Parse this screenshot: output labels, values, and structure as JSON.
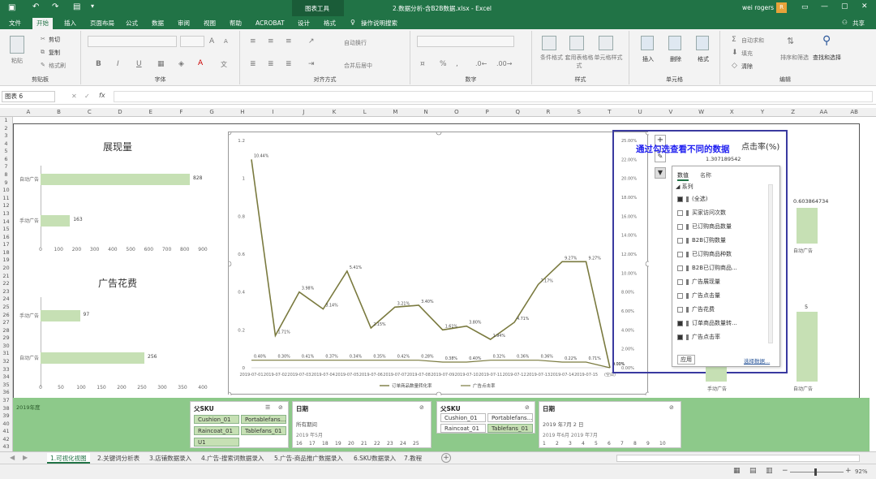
{
  "window": {
    "file_title": "2.数据分析-含B2B数据.xlsx - Excel",
    "context_title": "图表工具",
    "user": "wei rogers",
    "user_initial": "R"
  },
  "ribbon_tabs": [
    "文件",
    "开始",
    "插入",
    "页面布局",
    "公式",
    "数据",
    "审阅",
    "视图",
    "帮助",
    "ACROBAT",
    "设计",
    "格式"
  ],
  "tell_me": "操作说明搜索",
  "share": "共享",
  "ribbon": {
    "clipboard": {
      "cut": "剪切",
      "copy": "复制",
      "paste": "粘贴",
      "painter": "格式刷",
      "label": "剪贴板"
    },
    "font": {
      "bold": "B",
      "italic": "I",
      "underline": "U",
      "grow": "A",
      "shrink": "A",
      "color_a": "A",
      "wen": "文",
      "label": "字体"
    },
    "align": {
      "wrap": "自动换行",
      "merge": "合并后居中",
      "label": "对齐方式"
    },
    "number": {
      "label": "数字",
      "pct": "%",
      "comma": ","
    },
    "styles": {
      "cond": "条件格式",
      "table": "套用表格格式",
      "cell": "单元格样式",
      "label": "样式"
    },
    "cells": {
      "insert": "插入",
      "delete": "删除",
      "format": "格式",
      "label": "单元格"
    },
    "editing": {
      "autosum": "自动求和",
      "fill": "填充",
      "clear": "清除",
      "sort": "排序和筛选",
      "find": "查找和选择",
      "label": "编辑"
    }
  },
  "formula_bar": {
    "name_box": "图表 6",
    "fx": "fx",
    "value": ""
  },
  "columns": [
    "A",
    "B",
    "C",
    "D",
    "E",
    "F",
    "G",
    "H",
    "I",
    "J",
    "K",
    "L",
    "M",
    "N",
    "O",
    "P",
    "Q",
    "R",
    "S",
    "T",
    "U",
    "V",
    "W",
    "X",
    "Y",
    "Z",
    "AA",
    "AB"
  ],
  "rows": [
    "1",
    "2",
    "3",
    "4",
    "5",
    "6",
    "7",
    "8",
    "9",
    "10",
    "11",
    "12",
    "13",
    "14",
    "15",
    "16",
    "17",
    "18",
    "19",
    "20",
    "21",
    "22",
    "23",
    "24",
    "25",
    "26",
    "27",
    "28",
    "29",
    "30",
    "31",
    "32",
    "33",
    "34",
    "35",
    "36",
    "37",
    "38",
    "39",
    "40",
    "41",
    "42",
    "43"
  ],
  "charts": {
    "impressions": {
      "title": "展现量",
      "bars": [
        {
          "label": "自动广告",
          "value": 828
        },
        {
          "label": "手动广告",
          "value": 163
        }
      ],
      "axis": [
        "0",
        "100",
        "200",
        "300",
        "400",
        "500",
        "600",
        "700",
        "800",
        "900"
      ],
      "max": 900
    },
    "spend": {
      "title": "广告花费",
      "bars": [
        {
          "label": "手动广告",
          "value": 97
        },
        {
          "label": "自动广告",
          "value": 256
        }
      ],
      "axis": [
        "0",
        "50",
        "100",
        "150",
        "200",
        "250",
        "300",
        "350",
        "400"
      ],
      "max": 400
    },
    "ctr": {
      "title": "点击率(%)",
      "top_value": "1.307189542",
      "bars": [
        {
          "label": "手动广告",
          "value": "1.307189542"
        },
        {
          "label": "自动广告",
          "value": "0.603864734"
        }
      ],
      "bottom_label": "5"
    }
  },
  "chart_data": {
    "type": "line",
    "x": [
      "2019-07-01",
      "2019-07-02",
      "2019-07-03",
      "2019-07-04",
      "2019-07-05",
      "2019-07-06",
      "2019-07-07",
      "2019-07-08",
      "2019-07-09",
      "2019-07-10",
      "2019-07-11",
      "2019-07-12",
      "2019-07-13",
      "2019-07-14",
      "2019-07-15",
      "(空白)"
    ],
    "x_ticks": [
      "2019-07-01",
      "2019-07-02",
      "2019-07-03",
      "2019-07-04",
      "2019-07-05",
      "2019-07-06",
      "2019-07-07",
      "2019-07-08",
      "2019-07-09",
      "2019-07-10",
      "2019-07-11",
      "2019-07-12",
      "2019-07-13",
      "2019-07-14",
      "2019-07-15",
      "(空白)"
    ],
    "series": [
      {
        "name": "订单商品数量转化率",
        "axis": "left",
        "values": [
          1.1,
          0.17,
          0.4,
          0.31,
          0.51,
          0.21,
          0.32,
          0.33,
          0.2,
          0.22,
          0.15,
          0.24,
          0.44,
          0.56,
          0.56,
          0.0
        ],
        "labels": [
          "10.44%",
          "1.71%",
          "3.98%",
          "3.14%",
          "5.41%",
          "2.15%",
          "3.21%",
          "3.40%",
          "1.61%",
          "3.80%",
          "1.94%",
          "4.71%",
          "7.17%",
          "9.27%",
          "9.27%",
          "0.00%"
        ]
      },
      {
        "name": "广告点击率",
        "axis": "right",
        "values": [
          0.04,
          0.04,
          0.04,
          0.04,
          0.04,
          0.04,
          0.04,
          0.04,
          0.03,
          0.03,
          0.04,
          0.04,
          0.04,
          0.03,
          0.03,
          0.0
        ],
        "labels": [
          "0.40%",
          "0.30%",
          "0.41%",
          "0.37%",
          "0.34%",
          "0.35%",
          "0.42%",
          "0.28%",
          "0.38%",
          "0.40%",
          "0.32%",
          "0.36%",
          "0.36%",
          "0.22%",
          "0.71%",
          "0.00%"
        ]
      }
    ],
    "y_left": [
      "0",
      "0.2",
      "0.4",
      "0.6",
      "0.8",
      "1",
      "1.2"
    ],
    "y_right": [
      "0.00%",
      "2.00%",
      "4.00%",
      "6.00%",
      "8.00%",
      "10.00%",
      "12.00%",
      "14.00%",
      "16.00%",
      "18.00%",
      "20.00%",
      "22.00%",
      "25.00%"
    ],
    "ylim": [
      0,
      1.2
    ]
  },
  "callout": "通过勾选查看不同的数据",
  "filter": {
    "tabs": [
      "数值",
      "名称"
    ],
    "group": "系列",
    "items": [
      {
        "label": "(全选)",
        "checked": true
      },
      {
        "label": "买家访问次数",
        "checked": false
      },
      {
        "label": "已订购商品数量",
        "checked": false
      },
      {
        "label": "B2B订购数量",
        "checked": false
      },
      {
        "label": "已订购商品种数",
        "checked": false
      },
      {
        "label": "B2B已订购商品...",
        "checked": false
      },
      {
        "label": "广告展现量",
        "checked": false
      },
      {
        "label": "广告点击量",
        "checked": false
      },
      {
        "label": "广告花费",
        "checked": false
      },
      {
        "label": "订单商品数量转...",
        "checked": true
      },
      {
        "label": "广告点击率",
        "checked": true
      }
    ],
    "apply": "应用",
    "select_data": "选择数据..."
  },
  "slicers": {
    "band_label": "2019年度",
    "sku1": {
      "title": "父SKU",
      "items": [
        {
          "label": "Cushion_01",
          "on": true
        },
        {
          "label": "Portablefans...",
          "on": true
        },
        {
          "label": "Raincoat_01",
          "on": true
        },
        {
          "label": "Tablefans_01",
          "on": true
        },
        {
          "label": "U1",
          "on": true
        }
      ]
    },
    "date1": {
      "title": "日期",
      "sub": "所有期间",
      "months": "2019 年5月",
      "days": [
        "16",
        "17",
        "18",
        "19",
        "20",
        "21",
        "22",
        "23",
        "24",
        "25"
      ]
    },
    "sku2": {
      "title": "父SKU",
      "items": [
        {
          "label": "Cushion_01",
          "on": false
        },
        {
          "label": "Portablefans...",
          "on": false
        },
        {
          "label": "Raincoat_01",
          "on": false
        },
        {
          "label": "Tablefans_01",
          "on": true
        }
      ]
    },
    "date2": {
      "title": "日期",
      "sub": "2019 年7月 2 日",
      "months": "2019 年6月 2019 年7月",
      "days": [
        "1",
        "2",
        "3",
        "4",
        "5",
        "6",
        "7",
        "8",
        "9",
        "10"
      ]
    }
  },
  "sheet_tabs": [
    "1.可视化视图",
    "2.关键词分析表",
    "3.店铺数据录入",
    "4.广告-搜索词数据录入",
    "5.广告-商品推广数据录入",
    "6.SKU数据录入",
    "7.教程"
  ],
  "status": {
    "zoom": "92%"
  },
  "colors": {
    "excel_green": "#217346",
    "line_dark": "#7a7a3f",
    "bar_green": "#c6e0b4",
    "accent_blue": "#1f1ff0"
  }
}
